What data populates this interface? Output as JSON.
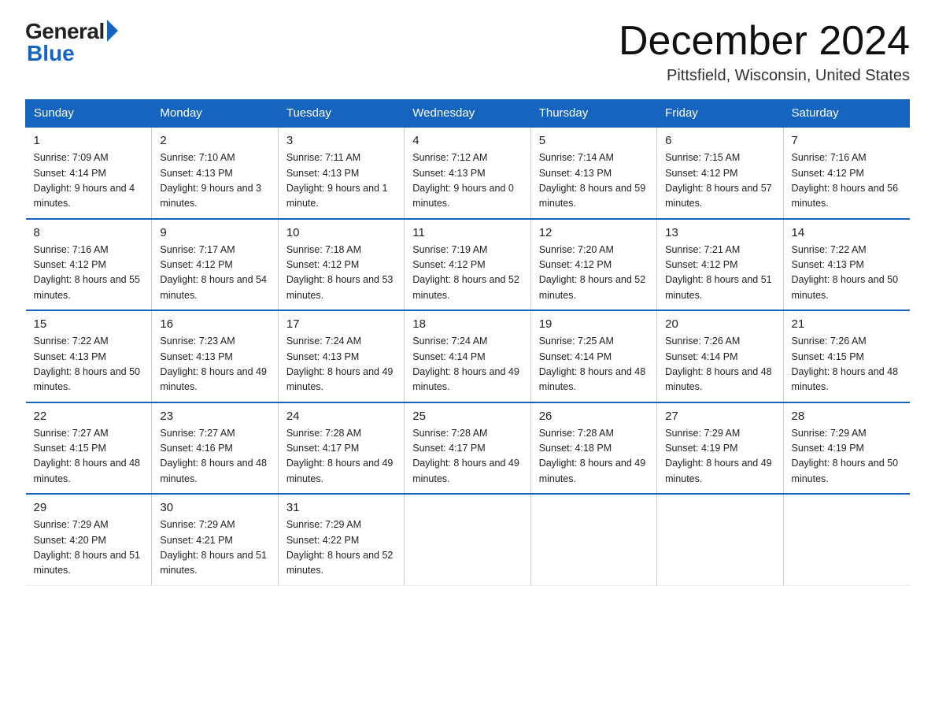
{
  "logo": {
    "general": "General",
    "blue": "Blue"
  },
  "header": {
    "month": "December 2024",
    "location": "Pittsfield, Wisconsin, United States"
  },
  "weekdays": [
    "Sunday",
    "Monday",
    "Tuesday",
    "Wednesday",
    "Thursday",
    "Friday",
    "Saturday"
  ],
  "weeks": [
    [
      {
        "day": "1",
        "sunrise": "7:09 AM",
        "sunset": "4:14 PM",
        "daylight": "9 hours and 4 minutes."
      },
      {
        "day": "2",
        "sunrise": "7:10 AM",
        "sunset": "4:13 PM",
        "daylight": "9 hours and 3 minutes."
      },
      {
        "day": "3",
        "sunrise": "7:11 AM",
        "sunset": "4:13 PM",
        "daylight": "9 hours and 1 minute."
      },
      {
        "day": "4",
        "sunrise": "7:12 AM",
        "sunset": "4:13 PM",
        "daylight": "9 hours and 0 minutes."
      },
      {
        "day": "5",
        "sunrise": "7:14 AM",
        "sunset": "4:13 PM",
        "daylight": "8 hours and 59 minutes."
      },
      {
        "day": "6",
        "sunrise": "7:15 AM",
        "sunset": "4:12 PM",
        "daylight": "8 hours and 57 minutes."
      },
      {
        "day": "7",
        "sunrise": "7:16 AM",
        "sunset": "4:12 PM",
        "daylight": "8 hours and 56 minutes."
      }
    ],
    [
      {
        "day": "8",
        "sunrise": "7:16 AM",
        "sunset": "4:12 PM",
        "daylight": "8 hours and 55 minutes."
      },
      {
        "day": "9",
        "sunrise": "7:17 AM",
        "sunset": "4:12 PM",
        "daylight": "8 hours and 54 minutes."
      },
      {
        "day": "10",
        "sunrise": "7:18 AM",
        "sunset": "4:12 PM",
        "daylight": "8 hours and 53 minutes."
      },
      {
        "day": "11",
        "sunrise": "7:19 AM",
        "sunset": "4:12 PM",
        "daylight": "8 hours and 52 minutes."
      },
      {
        "day": "12",
        "sunrise": "7:20 AM",
        "sunset": "4:12 PM",
        "daylight": "8 hours and 52 minutes."
      },
      {
        "day": "13",
        "sunrise": "7:21 AM",
        "sunset": "4:12 PM",
        "daylight": "8 hours and 51 minutes."
      },
      {
        "day": "14",
        "sunrise": "7:22 AM",
        "sunset": "4:13 PM",
        "daylight": "8 hours and 50 minutes."
      }
    ],
    [
      {
        "day": "15",
        "sunrise": "7:22 AM",
        "sunset": "4:13 PM",
        "daylight": "8 hours and 50 minutes."
      },
      {
        "day": "16",
        "sunrise": "7:23 AM",
        "sunset": "4:13 PM",
        "daylight": "8 hours and 49 minutes."
      },
      {
        "day": "17",
        "sunrise": "7:24 AM",
        "sunset": "4:13 PM",
        "daylight": "8 hours and 49 minutes."
      },
      {
        "day": "18",
        "sunrise": "7:24 AM",
        "sunset": "4:14 PM",
        "daylight": "8 hours and 49 minutes."
      },
      {
        "day": "19",
        "sunrise": "7:25 AM",
        "sunset": "4:14 PM",
        "daylight": "8 hours and 48 minutes."
      },
      {
        "day": "20",
        "sunrise": "7:26 AM",
        "sunset": "4:14 PM",
        "daylight": "8 hours and 48 minutes."
      },
      {
        "day": "21",
        "sunrise": "7:26 AM",
        "sunset": "4:15 PM",
        "daylight": "8 hours and 48 minutes."
      }
    ],
    [
      {
        "day": "22",
        "sunrise": "7:27 AM",
        "sunset": "4:15 PM",
        "daylight": "8 hours and 48 minutes."
      },
      {
        "day": "23",
        "sunrise": "7:27 AM",
        "sunset": "4:16 PM",
        "daylight": "8 hours and 48 minutes."
      },
      {
        "day": "24",
        "sunrise": "7:28 AM",
        "sunset": "4:17 PM",
        "daylight": "8 hours and 49 minutes."
      },
      {
        "day": "25",
        "sunrise": "7:28 AM",
        "sunset": "4:17 PM",
        "daylight": "8 hours and 49 minutes."
      },
      {
        "day": "26",
        "sunrise": "7:28 AM",
        "sunset": "4:18 PM",
        "daylight": "8 hours and 49 minutes."
      },
      {
        "day": "27",
        "sunrise": "7:29 AM",
        "sunset": "4:19 PM",
        "daylight": "8 hours and 49 minutes."
      },
      {
        "day": "28",
        "sunrise": "7:29 AM",
        "sunset": "4:19 PM",
        "daylight": "8 hours and 50 minutes."
      }
    ],
    [
      {
        "day": "29",
        "sunrise": "7:29 AM",
        "sunset": "4:20 PM",
        "daylight": "8 hours and 51 minutes."
      },
      {
        "day": "30",
        "sunrise": "7:29 AM",
        "sunset": "4:21 PM",
        "daylight": "8 hours and 51 minutes."
      },
      {
        "day": "31",
        "sunrise": "7:29 AM",
        "sunset": "4:22 PM",
        "daylight": "8 hours and 52 minutes."
      },
      null,
      null,
      null,
      null
    ]
  ]
}
